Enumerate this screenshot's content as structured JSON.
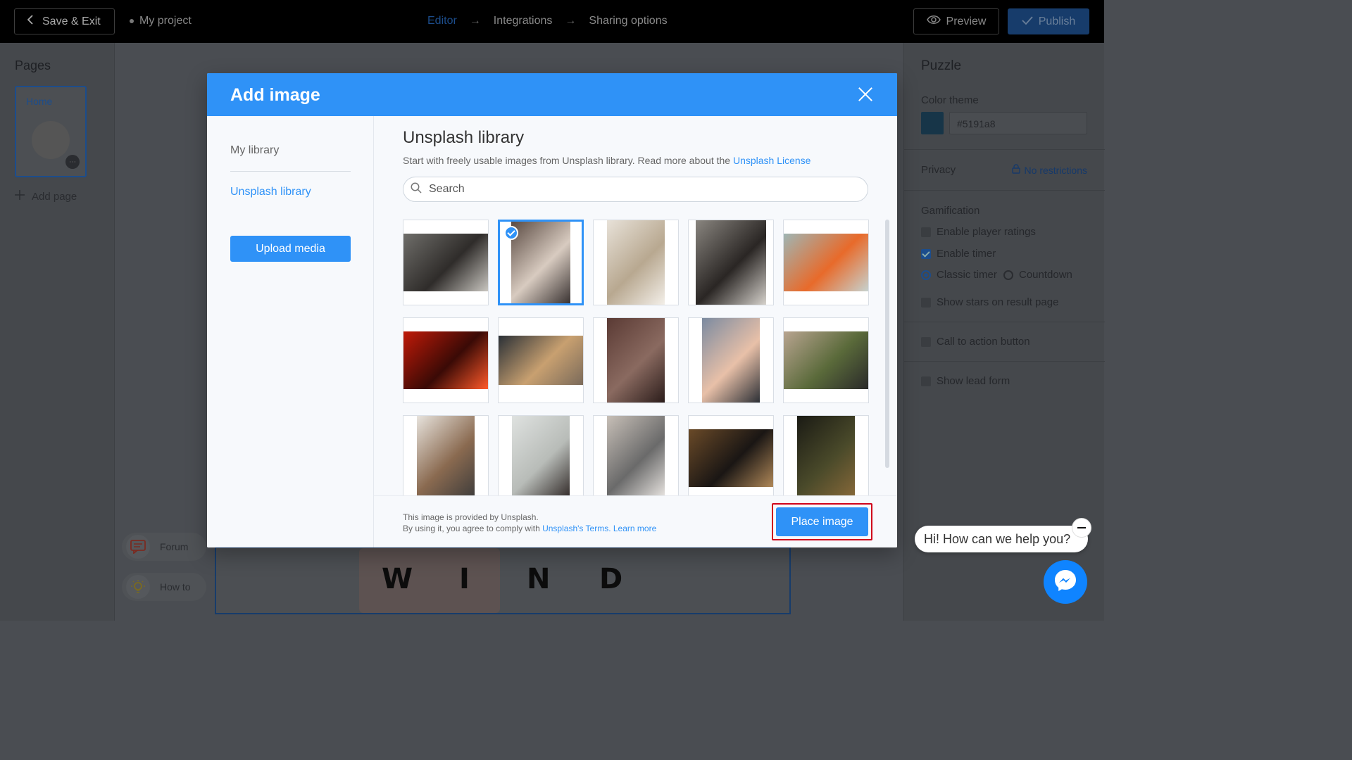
{
  "topbar": {
    "save_exit": "Save & Exit",
    "project_name": "My project",
    "steps": [
      "Editor",
      "Integrations",
      "Sharing options"
    ],
    "preview": "Preview",
    "publish": "Publish"
  },
  "left_panel": {
    "title": "Pages",
    "page_label": "Home",
    "add_page": "Add page"
  },
  "help": {
    "forum": "Forum",
    "howto": "How to"
  },
  "canvas": {
    "letters": [
      "W",
      "I",
      "N",
      "D"
    ]
  },
  "right_panel": {
    "title": "Puzzle",
    "color_theme_label": "Color theme",
    "color_value": "#5191a8",
    "privacy_label": "Privacy",
    "privacy_value": "No restrictions",
    "gamification_label": "Gamification",
    "player_ratings": "Enable player ratings",
    "enable_timer": "Enable timer",
    "classic_timer": "Classic timer",
    "countdown": "Countdown",
    "show_stars": "Show stars on result page",
    "cta_button": "Call to action button",
    "lead_form": "Show lead form"
  },
  "modal": {
    "title": "Add image",
    "sidebar": {
      "my_library": "My library",
      "unsplash_library": "Unsplash library",
      "upload": "Upload media"
    },
    "main": {
      "title": "Unsplash library",
      "description": "Start with freely usable images from Unsplash library. Read more about the ",
      "license_link": "Unsplash License",
      "search_placeholder": "Search"
    },
    "footer": {
      "line1": "This image is provided by Unsplash.",
      "line2": "By using it, you agree to comply with ",
      "terms_link": "Unsplash's Terms.",
      "learn_more": "Learn more",
      "place_button": "Place image"
    },
    "images": [
      {
        "subject": "man-at-laptop-photo",
        "selected": false,
        "colors": [
          "#6f6e6a",
          "#2f2c2a",
          "#c9c6c0"
        ]
      },
      {
        "subject": "bathtub-photo",
        "selected": true,
        "colors": [
          "#5a4a42",
          "#d8cbc0",
          "#3a3332"
        ]
      },
      {
        "subject": "building-photo",
        "selected": false,
        "colors": [
          "#e8e2d9",
          "#b8a890",
          "#f4f0ea"
        ]
      },
      {
        "subject": "man-with-plane-photo",
        "selected": false,
        "colors": [
          "#8a8680",
          "#2a2624",
          "#d8d4ce"
        ]
      },
      {
        "subject": "surfboard-photo",
        "selected": false,
        "colors": [
          "#9fb6b4",
          "#e86a2a",
          "#c6d2cf"
        ]
      },
      {
        "subject": "red-light-couple-photo",
        "selected": false,
        "colors": [
          "#c01a08",
          "#3a0a06",
          "#ff5a2a"
        ]
      },
      {
        "subject": "aerial-beach-photo",
        "selected": false,
        "colors": [
          "#2a3036",
          "#c8a070",
          "#7a6a5a"
        ]
      },
      {
        "subject": "car-and-wall-photo",
        "selected": false,
        "colors": [
          "#5a3a34",
          "#8a6a60",
          "#2a1c1a"
        ]
      },
      {
        "subject": "phone-city-photo",
        "selected": false,
        "colors": [
          "#7a8aa0",
          "#e8c0a8",
          "#2a2e34"
        ]
      },
      {
        "subject": "woman-camera-photo",
        "selected": false,
        "colors": [
          "#b8a490",
          "#5a6a3a",
          "#2a2a2a"
        ]
      },
      {
        "subject": "dining-room-photo",
        "selected": false,
        "colors": [
          "#e8e4de",
          "#8a6a50",
          "#3a3a3a"
        ]
      },
      {
        "subject": "woman-sea-photo",
        "selected": false,
        "colors": [
          "#dfe2e0",
          "#b8bcb8",
          "#2a2220"
        ]
      },
      {
        "subject": "two-women-beach-photo",
        "selected": false,
        "colors": [
          "#c8c0b8",
          "#6a6a6a",
          "#f0ece8"
        ]
      },
      {
        "subject": "camera-on-wood-photo",
        "selected": false,
        "colors": [
          "#6a4a28",
          "#1a1614",
          "#b08858"
        ]
      },
      {
        "subject": "dark-landscape-photo",
        "selected": false,
        "colors": [
          "#1a1a14",
          "#4a4a2a",
          "#8a6a3a"
        ]
      }
    ]
  },
  "chat": {
    "greeting": "Hi! How can we help you?"
  }
}
